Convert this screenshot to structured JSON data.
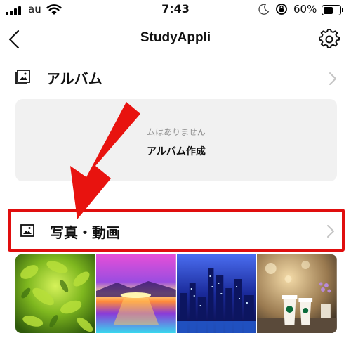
{
  "status_bar": {
    "carrier": "au",
    "time": "7:43",
    "battery_percent": "60%",
    "battery_level": 0.6
  },
  "nav": {
    "title": "StudyAppli",
    "back_icon": "chevron-left-icon",
    "settings_icon": "gear-icon"
  },
  "album_section": {
    "label": "アルバム",
    "empty_message": "ムはありません",
    "create_label": "アルバム作成"
  },
  "photo_section": {
    "label": "写真・動画",
    "highlight_color": "#e00e0e"
  },
  "thumbnails": [
    {
      "name": "thumbnail-green-plant"
    },
    {
      "name": "thumbnail-sunset-sea"
    },
    {
      "name": "thumbnail-city-night"
    },
    {
      "name": "thumbnail-coffee-cups"
    }
  ],
  "annotation": {
    "arrow_color": "#e8130f"
  }
}
